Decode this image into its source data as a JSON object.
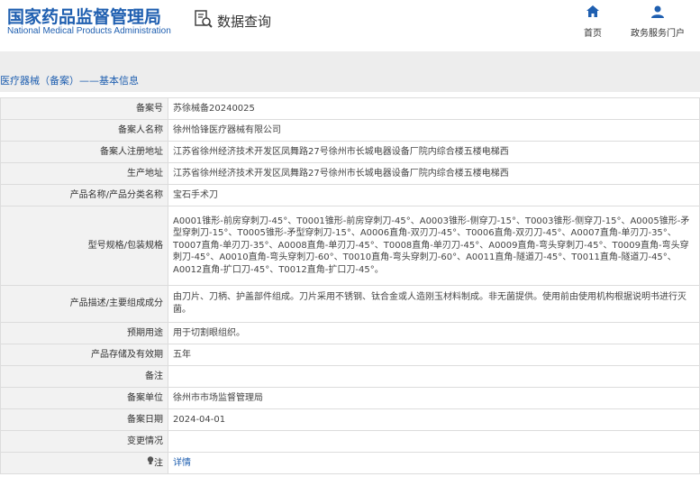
{
  "header": {
    "logo_cn": "国家药品监督管理局",
    "logo_en": "National Medical Products Administration",
    "search_label": "数据查询",
    "nav_home": "首页",
    "nav_service": "政务服务门户"
  },
  "breadcrumb": "医疗器械（备案）——基本信息",
  "rows": [
    {
      "label": "备案号",
      "value": "苏徐械备20240025"
    },
    {
      "label": "备案人名称",
      "value": "徐州恰锋医疗器械有限公司"
    },
    {
      "label": "备案人注册地址",
      "value": "江苏省徐州经济技术开发区凤舞路27号徐州市长城电器设备厂院内综合楼五楼电梯西"
    },
    {
      "label": "生产地址",
      "value": "江苏省徐州经济技术开发区凤舞路27号徐州市长城电器设备厂院内综合楼五楼电梯西"
    },
    {
      "label": "产品名称/产品分类名称",
      "value": "宝石手术刀"
    },
    {
      "label": "型号规格/包装规格",
      "value": "A0001锥形-前房穿刺刀-45°、T0001锥形-前房穿刺刀-45°、A0003锥形-侧穿刀-15°、T0003锥形-侧穿刀-15°、A0005锥形-矛型穿刺刀-15°、T0005锥形-矛型穿刺刀-15°、A0006直角-双刃刀-45°、T0006直角-双刃刀-45°、A0007直角-单刃刀-35°、T0007直角-单刃刀-35°、A0008直角-单刃刀-45°、T0008直角-单刃刀-45°、A0009直角-弯头穿刺刀-45°、T0009直角-弯头穿刺刀-45°、A0010直角-弯头穿刺刀-60°、T0010直角-弯头穿刺刀-60°、A0011直角-隧道刀-45°、T0011直角-隧道刀-45°、A0012直角-扩口刀-45°、T0012直角-扩口刀-45°。"
    },
    {
      "label": "产品描述/主要组成成分",
      "value": "由刀片、刀柄、护盖部件组成。刀片采用不锈钢、钛合金或人造刚玉材料制成。非无菌提供。使用前由使用机构根据说明书进行灭菌。"
    },
    {
      "label": "预期用途",
      "value": "用于切割眼组织。"
    },
    {
      "label": "产品存储及有效期",
      "value": "五年"
    },
    {
      "label": "备注",
      "value": ""
    },
    {
      "label": "备案单位",
      "value": "徐州市市场监督管理局"
    },
    {
      "label": "备案日期",
      "value": "2024-04-01"
    },
    {
      "label": "变更情况",
      "value": ""
    }
  ],
  "note": {
    "label": "注",
    "link": "详情"
  }
}
